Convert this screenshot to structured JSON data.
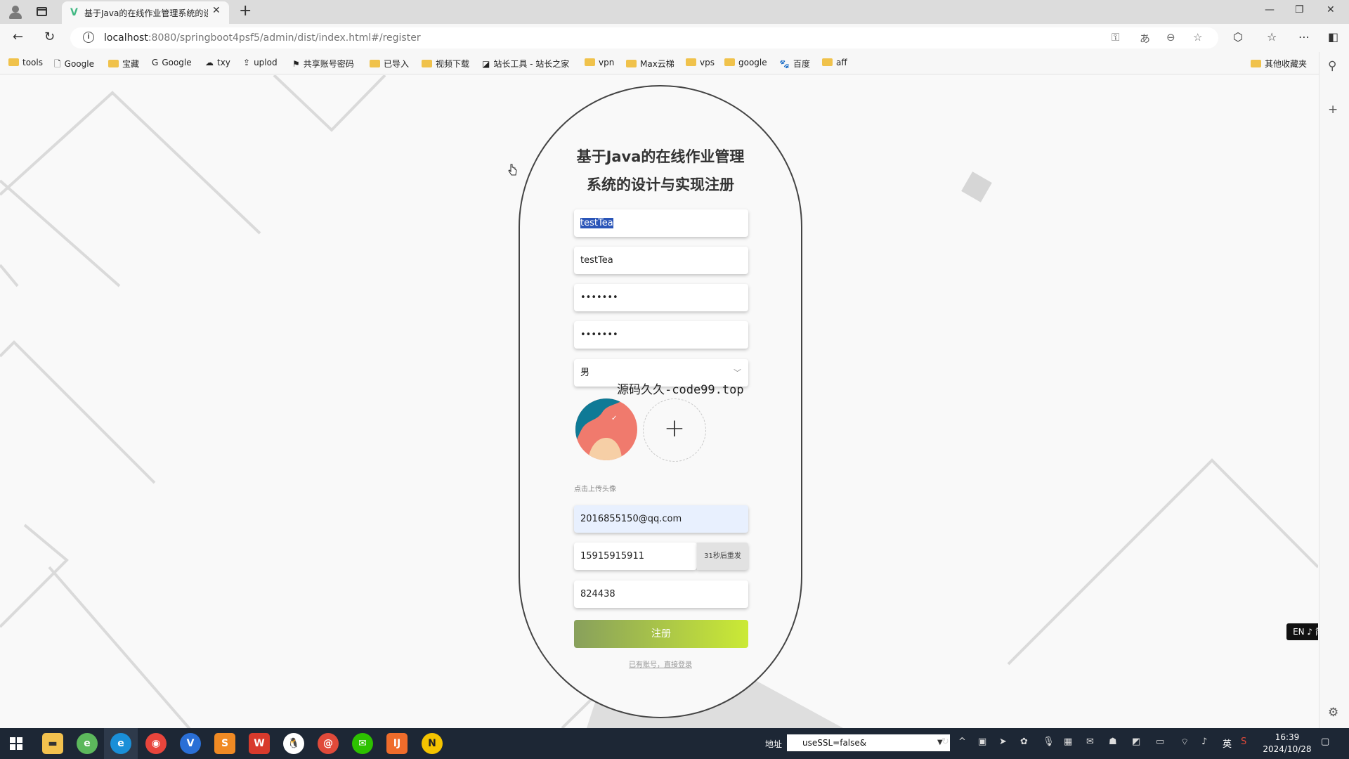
{
  "browser": {
    "tab_title": "基于Java的在线作业管理系统的设",
    "url_host": "localhost",
    "url_rest": ":8080/springboot4psf5/admin/dist/index.html#/register",
    "bookmarks": [
      "tools",
      "Google",
      "宝藏",
      "Google",
      "txy",
      "uplod",
      "共享账号密码",
      "已导入",
      "视频下载",
      "站长工具 - 站长之家",
      "vpn",
      "Max云梯",
      "vps",
      "google",
      "百度",
      "aff"
    ],
    "other_bookmarks": "其他收藏夹"
  },
  "form": {
    "title_line1": "基于Java的在线作业管理",
    "title_line2": "系统的设计与实现注册",
    "account": "testTea",
    "name": "testTea",
    "password": "•••••••",
    "confirm_password": "•••••••",
    "gender": "男",
    "watermark": "源码久久-code99.top",
    "upload_hint": "点击上传头像",
    "email": "2016855150@qq.com",
    "phone": "15915915911",
    "resend_label": "31秒后重发",
    "code": "824438",
    "submit_label": "注册",
    "login_link": "已有账号，直接登录"
  },
  "ime": "EN ♪ 简",
  "taskbar": {
    "address_label": "地址",
    "address_value": "useSSL=false&",
    "input_lang": "英",
    "time": "16:39",
    "date": "2024/10/28"
  },
  "colors": {
    "submit_start": "#88a05c",
    "submit_end": "#cbea35",
    "taskbar": "#1d2735"
  }
}
